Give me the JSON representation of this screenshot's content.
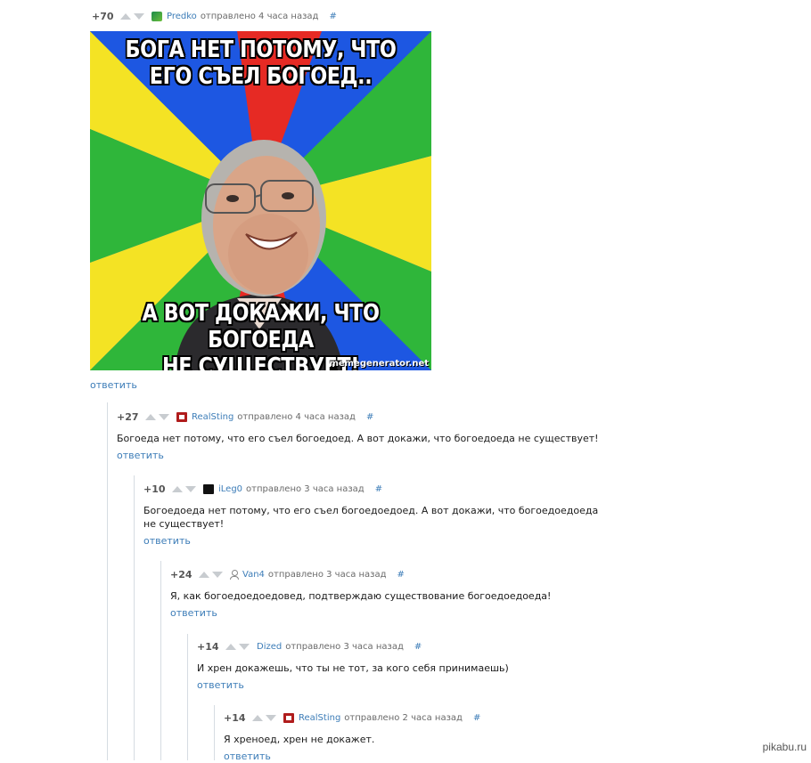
{
  "colors": {
    "link": "#3d7db8",
    "thread_line": "#d6dce2",
    "meme_blue": "#1d57e2",
    "meme_green": "#2fb63a",
    "meme_yellow": "#f4e324",
    "meme_red": "#e62a24"
  },
  "comments": [
    {
      "rating": "+70",
      "author": "Predko",
      "posted": "отправлено 4 часа назад",
      "hash": "#",
      "reply": "ответить",
      "avatar": "predko-avatar-icon"
    },
    {
      "rating": "+27",
      "author": "RealSting",
      "posted": "отправлено 4 часа назад",
      "hash": "#",
      "text": "Богоеда нет потому, что его съел богоедоед. А вот докажи, что богоедоеда не существует!",
      "reply": "ответить",
      "avatar": "realsting-avatar-icon"
    },
    {
      "rating": "+10",
      "author": "iLeg0",
      "posted": "отправлено 3 часа назад",
      "hash": "#",
      "text": "Богоедоеда нет потому, что его съел богоедоедоед. А вот докажи, что богоедоедоеда не существует!",
      "reply": "ответить",
      "avatar": "ileg0-avatar-icon"
    },
    {
      "rating": "+24",
      "author": "Van4",
      "posted": "отправлено 3 часа назад",
      "hash": "#",
      "text": "Я, как богоедоедоедовед, подтверждаю существование богоедоедоеда!",
      "reply": "ответить",
      "avatar": "default-user-icon"
    },
    {
      "rating": "+14",
      "author": "Dized",
      "posted": "отправлено 3 часа назад",
      "hash": "#",
      "text": "И хрен докажешь, что ты не тот, за кого себя принимаешь)",
      "reply": "ответить",
      "avatar": ""
    },
    {
      "rating": "+14",
      "author": "RealSting",
      "posted": "отправлено 2 часа назад",
      "hash": "#",
      "text": "Я хреноед, хрен не докажет.",
      "reply": "ответить",
      "avatar": "realsting-avatar-icon"
    }
  ],
  "meme": {
    "top_line1": "БОГА НЕТ ПОТОМУ, ЧТО",
    "top_line2": "ЕГО СЪЕЛ БОГОЕД..",
    "bottom_line1": "А ВОТ ДОКАЖИ, ЧТО БОГОЕДА",
    "bottom_line2": "НЕ СУЩЕСТВУЕТ!",
    "watermark": "memegenerator.net"
  },
  "site_logo": "pikabu.ru"
}
